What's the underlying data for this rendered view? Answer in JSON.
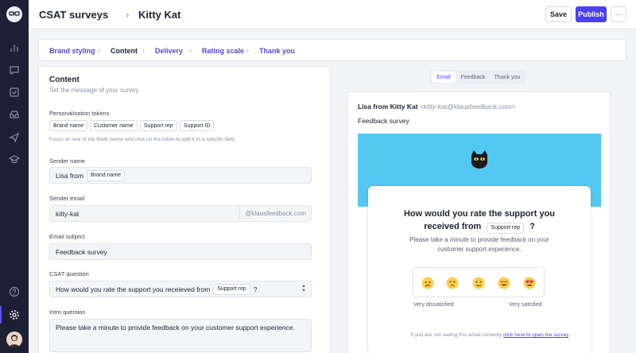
{
  "header": {
    "section": "CSAT surveys",
    "separator": "›",
    "survey_name": "Kitty Kat",
    "save_label": "Save",
    "publish_label": "Publish",
    "more_label": "···"
  },
  "steps": [
    {
      "label": "Brand styling"
    },
    {
      "label": "Content"
    },
    {
      "label": "Delivery"
    },
    {
      "label": "Rating scale"
    },
    {
      "label": "Thank you"
    }
  ],
  "content": {
    "title": "Content",
    "subtitle": "Set the message of your survey",
    "tokens_label": "Personalisation tokens",
    "tokens": [
      "Brand name",
      "Customer name",
      "Support rep",
      "Support ID"
    ],
    "tokens_hint": "Focus on one of the fields below and click on the token to add it to a specific field.",
    "sender_name_label": "Sender name",
    "sender_name_value": "Lisa from",
    "sender_name_token": "Brand name",
    "sender_email_label": "Sender email",
    "sender_email_value": "kitty-kat",
    "sender_email_suffix": "@klausfeedback.com",
    "email_subject_label": "Email subject",
    "email_subject_value": "Feedback survey",
    "csat_label": "CSAT question",
    "csat_value": "How would you rate the support you receieved from",
    "csat_token": "Support rep",
    "csat_suffix": "?",
    "intro_label": "Intro question",
    "intro_value": "Please take a minute to provide feedback on your customer support experience."
  },
  "preview": {
    "tabs": [
      "Email",
      "Feedback",
      "Thank you"
    ],
    "active_tab": "Email",
    "from_name": "Lisa from Kitty Kat",
    "from_address": "<kitty-kat@klausfeedback.com>",
    "subject": "Feedback survey",
    "banner_color": "#52c8f2",
    "question_line1": "How would you rate the support you",
    "question_line2": "received from",
    "question_token": "Support rep",
    "question_suffix": "?",
    "subtext": "Please take a minute to provide feedback on your customer support experience.",
    "scale_low": "Very dissatisfied",
    "scale_high": "Very satisfied",
    "footer_text": "If you are not seeing this email correctly",
    "footer_link": "click here to open the survey"
  },
  "icons": {
    "rail": [
      "logo-icon",
      "stats-icon",
      "chat-icon",
      "tasks-icon",
      "inbox-icon",
      "send-icon",
      "learn-icon",
      "help-icon",
      "settings-icon"
    ],
    "faces": [
      "very-dissatisfied-icon",
      "dissatisfied-icon",
      "neutral-icon",
      "satisfied-icon",
      "very-satisfied-icon"
    ]
  },
  "colors": {
    "accent": "#4b3ff2",
    "rail_bg": "#1d2034",
    "step_link": "#5248d6"
  }
}
